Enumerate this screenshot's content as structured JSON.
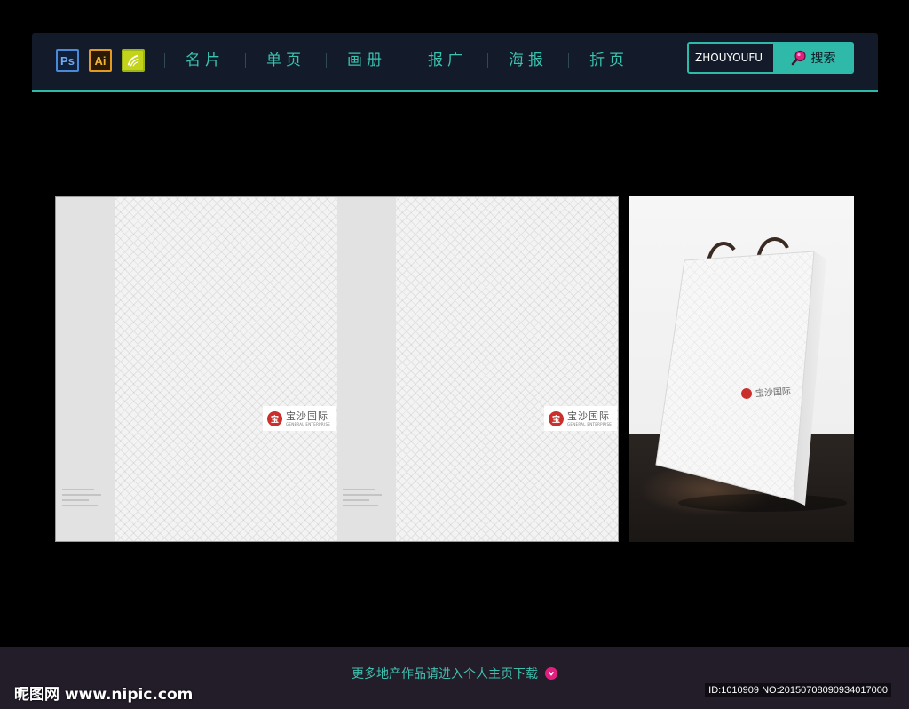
{
  "nav": {
    "apps": [
      {
        "label": "Ps",
        "icon": "photoshop-icon"
      },
      {
        "label": "Ai",
        "icon": "illustrator-icon"
      },
      {
        "label": "",
        "icon": "swirl-app-icon"
      }
    ],
    "items": [
      "名片",
      "单页",
      "画册",
      "报广",
      "海报",
      "折页"
    ]
  },
  "search": {
    "placeholder": "ZHOUYOUFU",
    "button_label": "搜索"
  },
  "preview": {
    "brand_cn": "宝沙国际",
    "brand_en": "GENERAL ENTERPRISE",
    "brand_mark": "宝"
  },
  "footer": {
    "cta": "更多地产作品请进入个人主页下载"
  },
  "watermark": {
    "site": "昵图网 www.nipic.com",
    "id": "ID:1010909 NO:20150708090934017000"
  },
  "colors": {
    "accent": "#2fb9a9",
    "nav_bg": "#131b2a",
    "footer_bg": "#231d2a",
    "cta_arrow": "#e0207f"
  }
}
